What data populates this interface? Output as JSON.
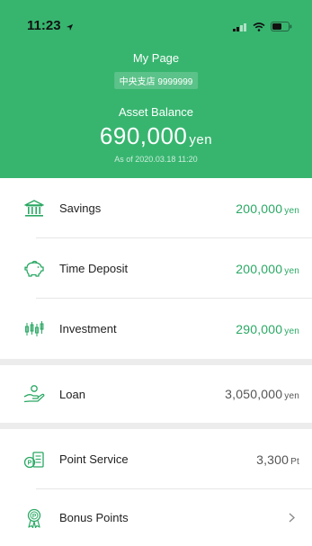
{
  "status_bar": {
    "time": "11:23"
  },
  "header": {
    "title": "My Page",
    "branch": "中央支店 9999999",
    "asset_label": "Asset Balance",
    "balance_value": "690,000",
    "balance_unit": "yen",
    "as_of": "As of 2020.03.18 11:20"
  },
  "accounts": [
    {
      "icon": "bank-icon",
      "label": "Savings",
      "value": "200,000",
      "unit": "yen"
    },
    {
      "icon": "piggy-bank-icon",
      "label": "Time Deposit",
      "value": "200,000",
      "unit": "yen"
    },
    {
      "icon": "candlestick-chart-icon",
      "label": "Investment",
      "value": "290,000",
      "unit": "yen"
    }
  ],
  "loan": {
    "icon": "hand-coin-icon",
    "label": "Loan",
    "value": "3,050,000",
    "unit": "yen"
  },
  "points": [
    {
      "icon": "point-card-icon",
      "label": "Point Service",
      "value": "3,300",
      "unit": "Pt"
    },
    {
      "icon": "award-medal-icon",
      "label": "Bonus Points"
    }
  ],
  "colors": {
    "brand": "#37b56f",
    "accent_text": "#2aa864",
    "background": "#ececec"
  }
}
